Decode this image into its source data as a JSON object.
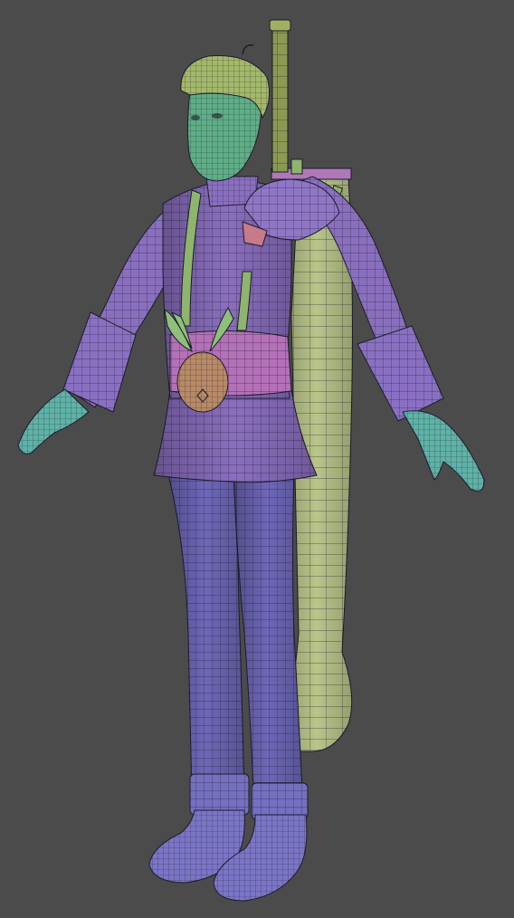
{
  "viewport": {
    "background": "#4b4b4b",
    "wire_color": "#1c1c2a"
  },
  "model": {
    "parts": [
      {
        "name": "head",
        "color": "#5fae86"
      },
      {
        "name": "hair",
        "color": "#a4b86a"
      },
      {
        "name": "torso",
        "color": "#8a6fbf"
      },
      {
        "name": "shoulder-pad",
        "color": "#8f76c6"
      },
      {
        "name": "belt",
        "color": "#b470b8"
      },
      {
        "name": "suspenders",
        "color": "#8fb46e"
      },
      {
        "name": "pouch",
        "color": "#b88a66"
      },
      {
        "name": "pouch-leaves",
        "color": "#8fc07a"
      },
      {
        "name": "hands",
        "color": "#5fb2a8"
      },
      {
        "name": "legs",
        "color": "#6e67b8"
      },
      {
        "name": "boots",
        "color": "#7b75c6"
      },
      {
        "name": "sword-scabbard",
        "color": "#b9c58a"
      },
      {
        "name": "sword-handle",
        "color": "#8a9a52"
      },
      {
        "name": "sword-guard",
        "color": "#b078b8"
      }
    ]
  }
}
